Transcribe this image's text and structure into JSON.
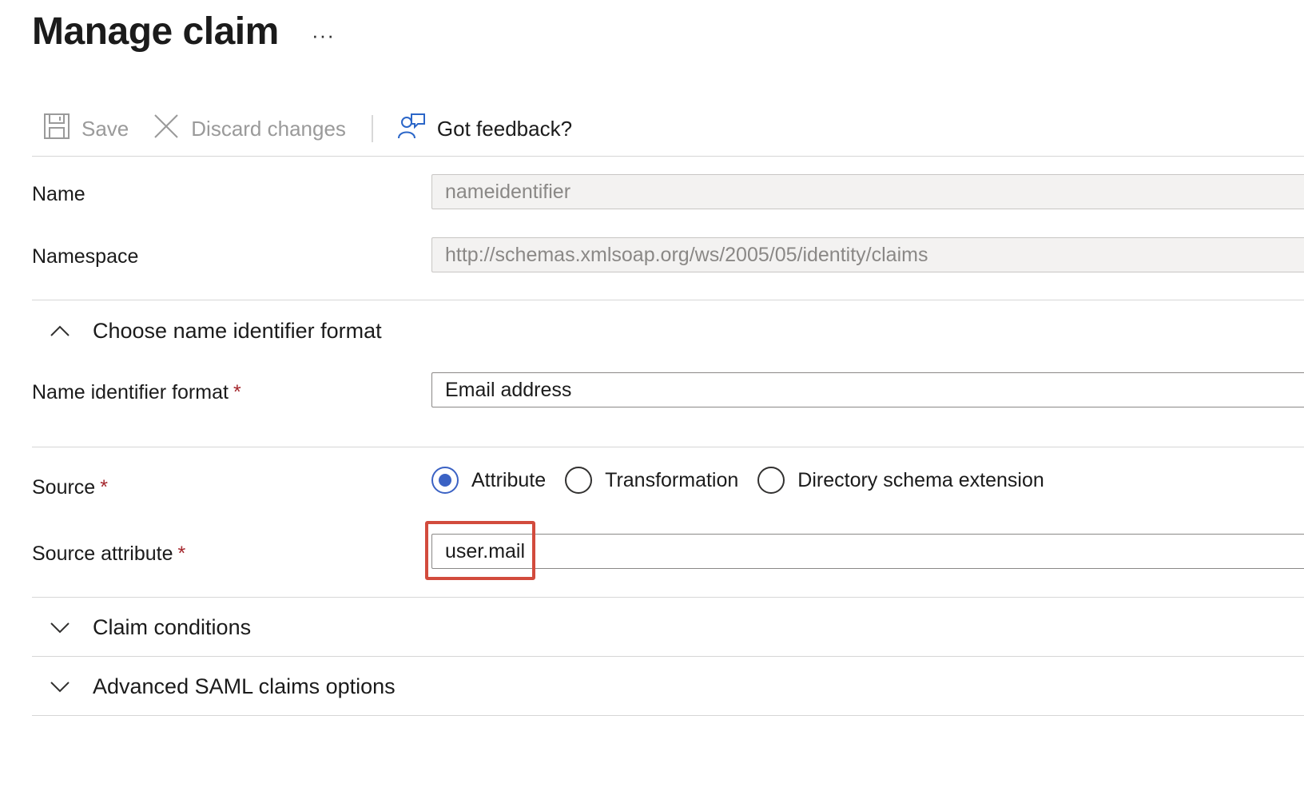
{
  "header": {
    "title": "Manage claim",
    "more_label": "···"
  },
  "toolbar": {
    "save_label": "Save",
    "discard_label": "Discard changes",
    "feedback_label": "Got feedback?"
  },
  "fields": {
    "name": {
      "label": "Name",
      "value": "nameidentifier"
    },
    "namespace": {
      "label": "Namespace",
      "value": "http://schemas.xmlsoap.org/ws/2005/05/identity/claims"
    }
  },
  "name_id_section": {
    "heading": "Choose name identifier format",
    "format_label": "Name identifier format",
    "format_value": "Email address",
    "required_marker": "*"
  },
  "source": {
    "label": "Source",
    "required_marker": "*",
    "options": [
      "Attribute",
      "Transformation",
      "Directory schema extension"
    ],
    "selected": "Attribute"
  },
  "source_attribute": {
    "label": "Source attribute",
    "required_marker": "*",
    "value": "user.mail"
  },
  "collapsed_sections": {
    "claim_conditions": "Claim conditions",
    "advanced_saml": "Advanced SAML claims options"
  },
  "colors": {
    "accent": "#3b62c4",
    "required": "#a4262c",
    "highlight_border": "#d24b3d"
  }
}
